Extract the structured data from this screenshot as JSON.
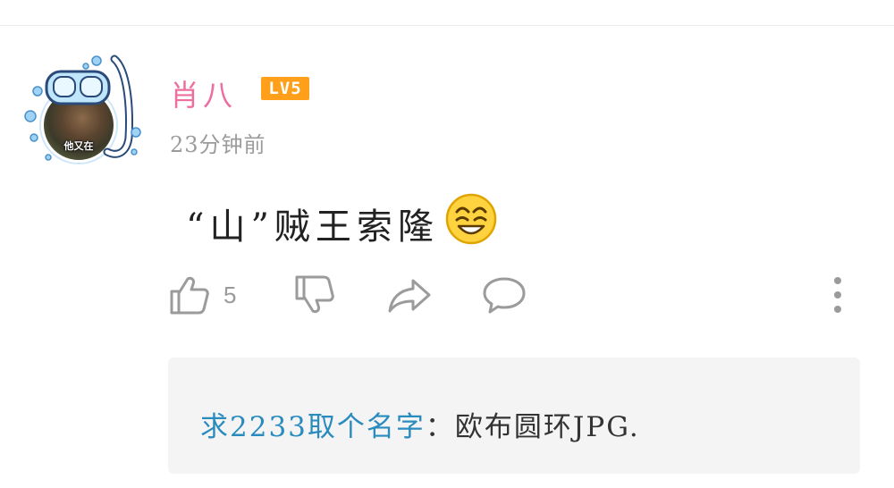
{
  "comment": {
    "username": "肖八",
    "level": "LV5",
    "timestamp": "23分钟前",
    "text": "“山”贼王索隆",
    "emoji": "grinning-face-emoji",
    "avatar_caption": "他又在",
    "likes": "5"
  },
  "actions": {
    "like_icon": "thumbs-up-icon",
    "dislike_icon": "thumbs-down-icon",
    "share_icon": "share-arrow-icon",
    "reply_icon": "speech-bubble-icon",
    "more_icon": "more-vertical-icon"
  },
  "reply": {
    "author": "求2233取个名字",
    "separator": "：",
    "body": "欧布圆环JPG."
  },
  "colors": {
    "username": "#ec6fa0",
    "level_badge": "#ff9f1a",
    "reply_author": "#2a8bbf",
    "muted": "#9b9b9b"
  }
}
